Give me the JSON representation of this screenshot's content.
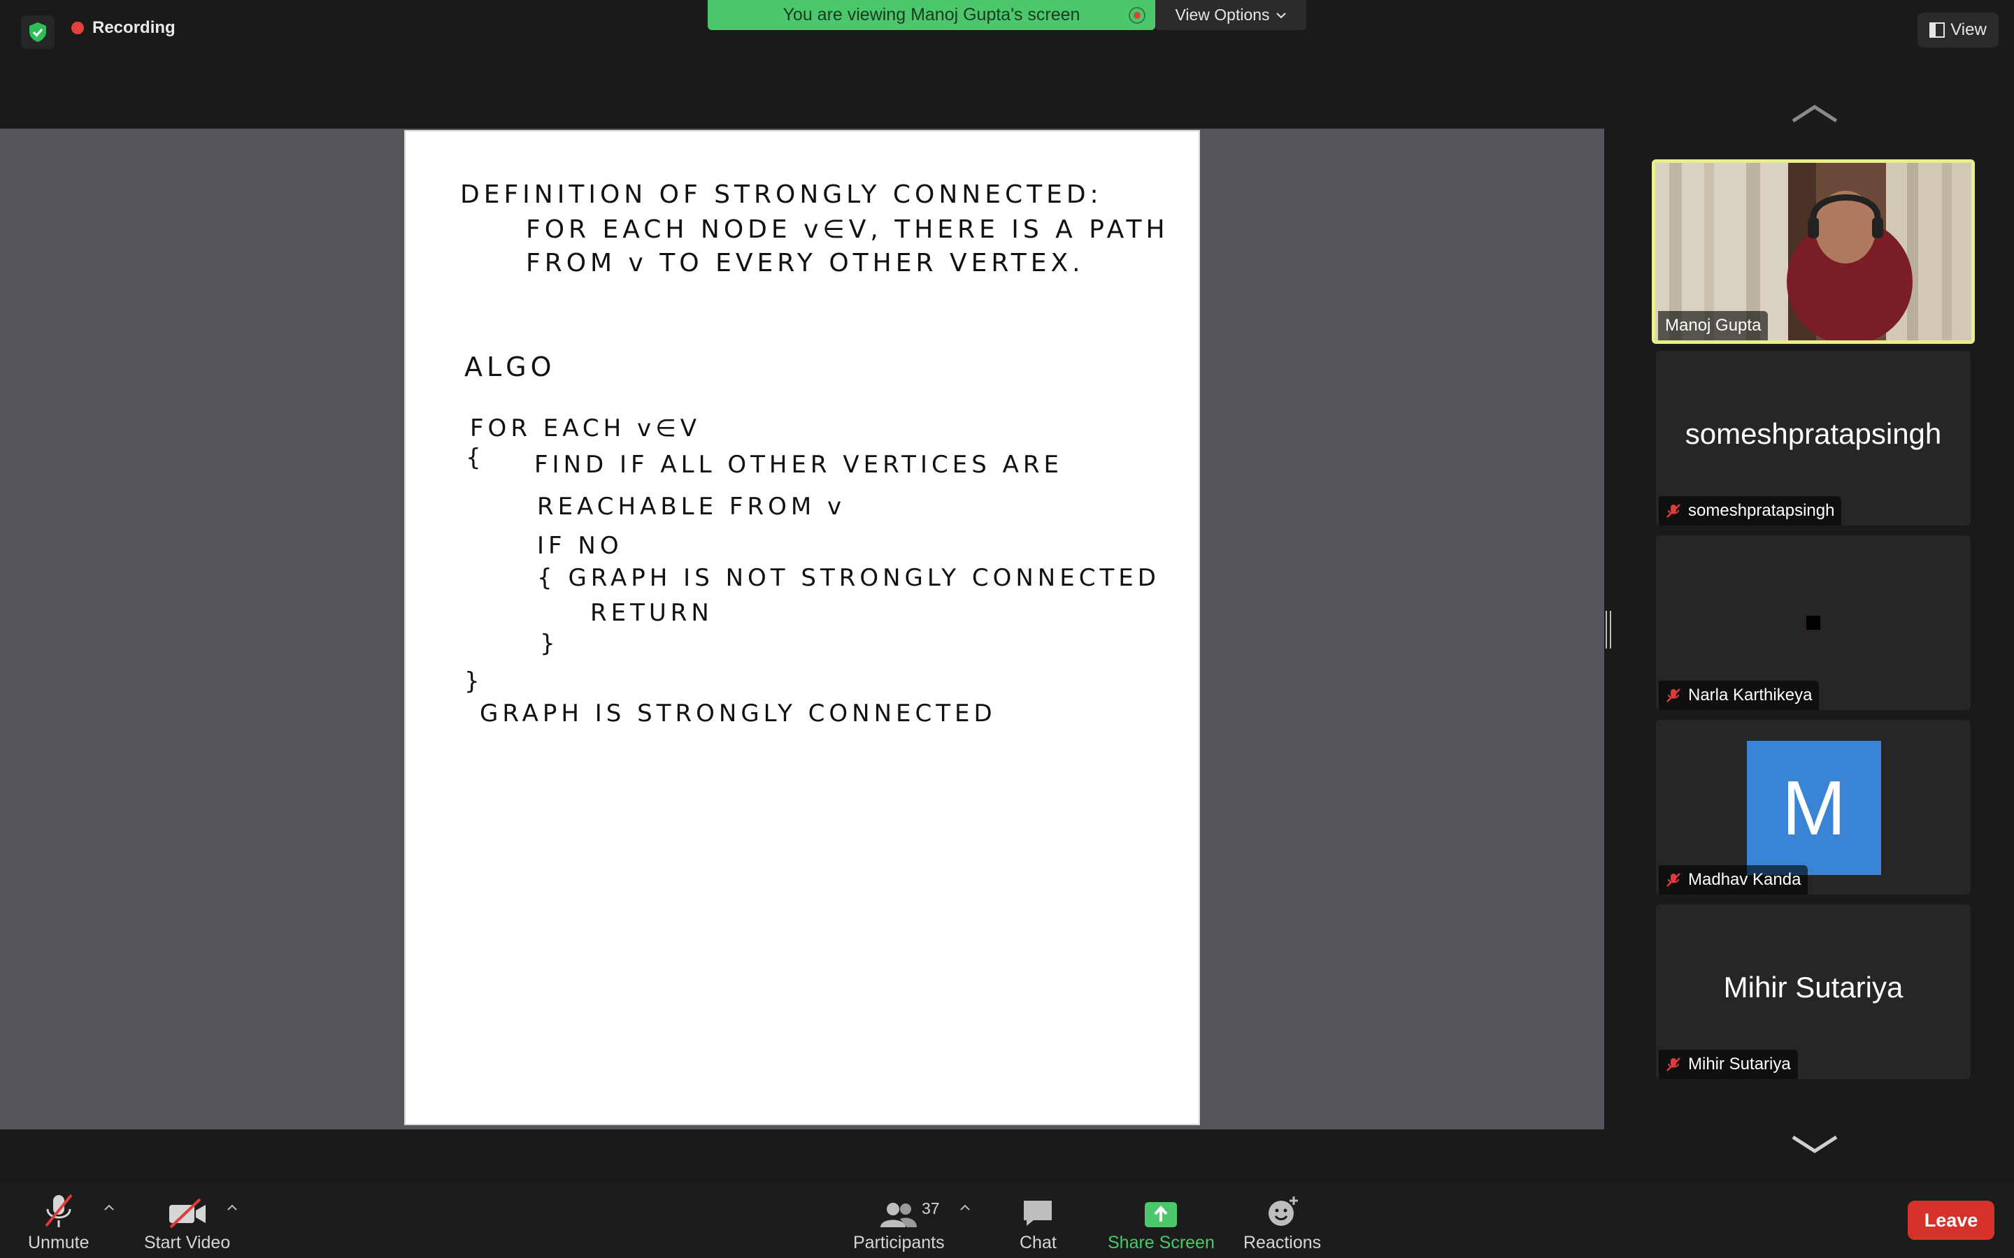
{
  "top": {
    "recording_label": "Recording",
    "banner_text": "You are viewing Manoj Gupta's screen",
    "view_options_label": "View Options",
    "view_label": "View"
  },
  "whiteboard": {
    "lines": [
      "DEFINITION OF STRONGLY CONNECTED:",
      "FOR EACH NODE v∈V, THERE IS A PATH",
      "FROM v TO EVERY OTHER VERTEX.",
      "ALGO",
      "FOR EACH v∈V",
      "{",
      "FIND IF ALL OTHER VERTICES ARE",
      "REACHABLE FROM v",
      "IF NO",
      "{ GRAPH IS NOT STRONGLY CONNECTED",
      "RETURN",
      "}",
      "}",
      "GRAPH IS STRONGLY CONNECTED"
    ]
  },
  "gallery": {
    "participants": [
      {
        "name": "Manoj Gupta",
        "display": "video",
        "active": true
      },
      {
        "name": "someshpratapsingh",
        "display": "name",
        "muted": true
      },
      {
        "name": "Narla Karthikeya",
        "display": "dark",
        "muted": true
      },
      {
        "name": "Madhav Kanda",
        "display": "avatar",
        "avatar_letter": "M",
        "avatar_color": "#3a84d6",
        "muted": true
      },
      {
        "name": "Mihir Sutariya",
        "display": "name",
        "muted": true
      }
    ]
  },
  "toolbar": {
    "unmute_label": "Unmute",
    "start_video_label": "Start Video",
    "participants_label": "Participants",
    "participants_count": "37",
    "chat_label": "Chat",
    "share_screen_label": "Share Screen",
    "reactions_label": "Reactions",
    "leave_label": "Leave"
  },
  "colors": {
    "banner": "#4cc76b",
    "leave": "#d6322a",
    "active_speaker_border": "#eaef8a",
    "share_screen": "#4cc76b",
    "recording_dot": "#e5403b"
  }
}
